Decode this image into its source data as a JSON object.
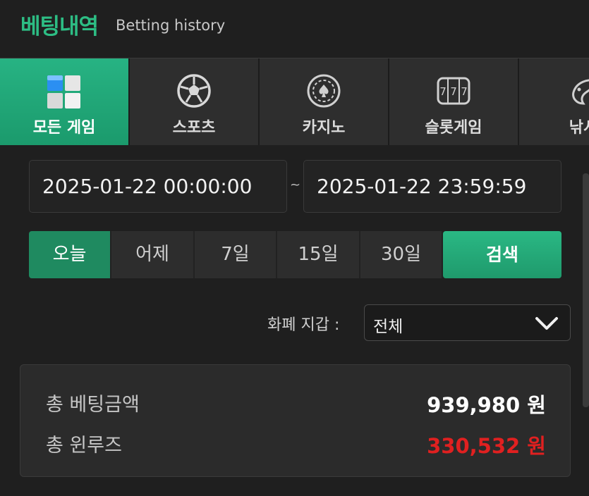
{
  "header": {
    "title_ko": "베팅내역",
    "title_en": "Betting history"
  },
  "tabs": [
    {
      "label": "모든 게임",
      "icon": "cube-grid-icon",
      "active": true
    },
    {
      "label": "스포츠",
      "icon": "soccer-ball-icon",
      "active": false
    },
    {
      "label": "카지노",
      "icon": "casino-chip-icon",
      "active": false
    },
    {
      "label": "슬롯게임",
      "icon": "slot-machine-icon",
      "active": false
    },
    {
      "label": "낚시",
      "icon": "fish-icon",
      "active": false
    }
  ],
  "date_range": {
    "start": "2025-01-22 00:00:00",
    "separator": "~",
    "end": "2025-01-22 23:59:59"
  },
  "quick_buttons": [
    {
      "label": "오늘",
      "active": true
    },
    {
      "label": "어제",
      "active": false
    },
    {
      "label": "7일",
      "active": false
    },
    {
      "label": "15일",
      "active": false
    },
    {
      "label": "30일",
      "active": false
    }
  ],
  "search_label": "검색",
  "currency": {
    "label": "화폐 지갑 :",
    "selected": "전체"
  },
  "summary": {
    "total_bet_label": "총 베팅금액",
    "total_bet_value": "939,980 원",
    "total_winloss_label": "총 윈루즈",
    "total_winloss_value": "330,532 원"
  },
  "colors": {
    "accent": "#2dbd84",
    "loss": "#e02020",
    "background": "#1f1f1f"
  }
}
